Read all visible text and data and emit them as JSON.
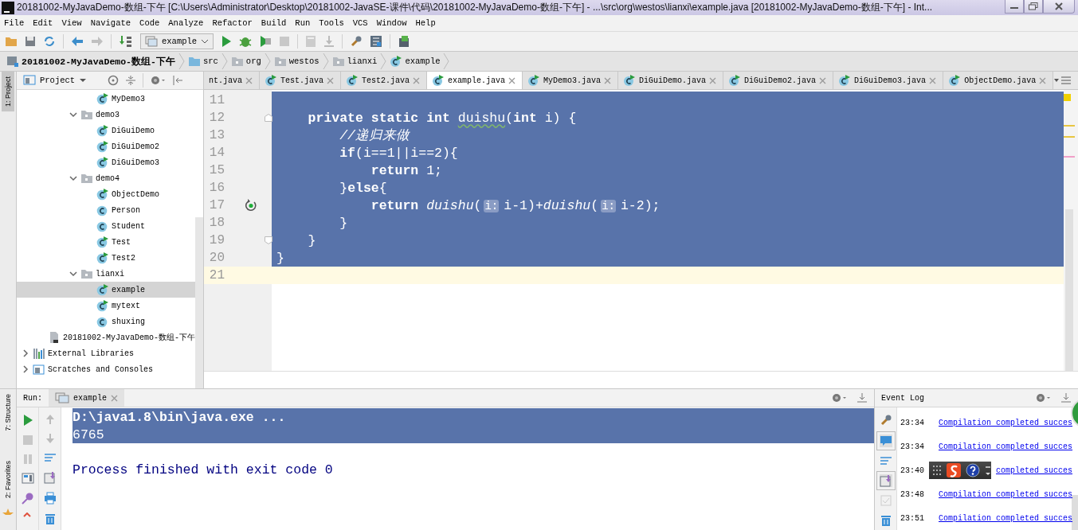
{
  "window": {
    "title": "20181002-MyJavaDemo-数组-下午 [C:\\Users\\Administrator\\Desktop\\20181002-JavaSE-课件\\代码\\20181002-MyJavaDemo-数组-下午] - ...\\src\\org\\westos\\lianxi\\example.java [20181002-MyJavaDemo-数组-下午] - Int..."
  },
  "menu": [
    "File",
    "Edit",
    "View",
    "Navigate",
    "Code",
    "Analyze",
    "Refactor",
    "Build",
    "Run",
    "Tools",
    "VCS",
    "Window",
    "Help"
  ],
  "toolbar": {
    "run_config": "example"
  },
  "breadcrumbs": [
    {
      "label": "20181002-MyJavaDemo-数组-下午",
      "kind": "module"
    },
    {
      "label": "src",
      "kind": "source-folder"
    },
    {
      "label": "org",
      "kind": "package"
    },
    {
      "label": "westos",
      "kind": "package"
    },
    {
      "label": "lianxi",
      "kind": "package"
    },
    {
      "label": "example",
      "kind": "class"
    }
  ],
  "left_strip": {
    "top": [
      {
        "label": "1: Project",
        "selected": true
      }
    ],
    "bottom": [
      {
        "label": "7: Structure",
        "selected": false
      },
      {
        "label": "2: Favorites",
        "selected": false
      }
    ]
  },
  "project": {
    "title": "Project",
    "tree": [
      {
        "children": [
          {
            "children": [
              {
                "children": [
                  {
                    "children": [
                      {
                        "label": "MyDemo3",
                        "kind": "class-main",
                        "selected": false
                      }
                    ]
                  },
                  {
                    "label": "demo3",
                    "kind": "package",
                    "expanded": true,
                    "selected": false,
                    "children": [
                      {
                        "label": "DiGuiDemo",
                        "kind": "class-main",
                        "selected": false
                      },
                      {
                        "label": "DiGuiDemo2",
                        "kind": "class-main",
                        "selected": false
                      },
                      {
                        "label": "DiGuiDemo3",
                        "kind": "class-main",
                        "selected": false
                      }
                    ]
                  },
                  {
                    "label": "demo4",
                    "kind": "package",
                    "expanded": true,
                    "selected": false,
                    "children": [
                      {
                        "label": "ObjectDemo",
                        "kind": "class-main",
                        "selected": false
                      },
                      {
                        "label": "Person",
                        "kind": "class",
                        "selected": false
                      },
                      {
                        "label": "Student",
                        "kind": "class",
                        "selected": false
                      },
                      {
                        "label": "Test",
                        "kind": "class-main",
                        "selected": false
                      },
                      {
                        "label": "Test2",
                        "kind": "class-main",
                        "selected": false
                      }
                    ]
                  },
                  {
                    "label": "lianxi",
                    "kind": "package",
                    "expanded": true,
                    "selected": false,
                    "children": [
                      {
                        "label": "example",
                        "kind": "class-main",
                        "selected": true
                      },
                      {
                        "label": "mytext",
                        "kind": "class-main",
                        "selected": false
                      },
                      {
                        "label": "shuxing",
                        "kind": "class",
                        "selected": false
                      }
                    ]
                  }
                ]
              }
            ]
          },
          {
            "label": "20181002-MyJavaDemo-数组-下午",
            "kind": "module-file",
            "selected": false
          }
        ]
      },
      {
        "label": "External Libraries",
        "kind": "libraries",
        "expanded": false,
        "selected": false
      },
      {
        "label": "Scratches and Consoles",
        "kind": "scratches",
        "expanded": false,
        "selected": false
      }
    ]
  },
  "tabs": [
    {
      "label": "nt.java",
      "kind": "cut",
      "selected": false
    },
    {
      "label": "Test.java",
      "kind": "class",
      "selected": false
    },
    {
      "label": "Test2.java",
      "kind": "class",
      "selected": false
    },
    {
      "label": "example.java",
      "kind": "class",
      "selected": true
    },
    {
      "label": "MyDemo3.java",
      "kind": "class",
      "selected": false
    },
    {
      "label": "DiGuiDemo.java",
      "kind": "class",
      "selected": false
    },
    {
      "label": "DiGuiDemo2.java",
      "kind": "class",
      "selected": false
    },
    {
      "label": "DiGuiDemo3.java",
      "kind": "class",
      "selected": false
    },
    {
      "label": "ObjectDemo.java",
      "kind": "class",
      "selected": false
    }
  ],
  "editor": {
    "lines": [
      {
        "number": "11",
        "kind": "plain",
        "selected": true,
        "current": false
      },
      {
        "number": "12",
        "kind": "fold-start",
        "selected": true,
        "current": false,
        "segments": [
          {
            "t": "    private static int ",
            "kind": "kw"
          },
          {
            "t": "duishu",
            "kind": "decl"
          },
          {
            "t": "(",
            "kind": "plain"
          },
          {
            "t": "int",
            "kind": "kw"
          },
          {
            "t": " i) {",
            "kind": "plain"
          }
        ]
      },
      {
        "number": "13",
        "kind": "plain",
        "selected": true,
        "current": false,
        "segments": [
          {
            "t": "        //递归来做",
            "kind": "comment"
          }
        ]
      },
      {
        "number": "14",
        "kind": "plain",
        "selected": true,
        "current": false,
        "segments": [
          {
            "t": "        if",
            "kind": "kw"
          },
          {
            "t": "(i==1||i==2){",
            "kind": "plain"
          }
        ]
      },
      {
        "number": "15",
        "kind": "plain",
        "selected": true,
        "current": false,
        "segments": [
          {
            "t": "            return",
            "kind": "kw"
          },
          {
            "t": " 1;",
            "kind": "plain"
          }
        ]
      },
      {
        "number": "16",
        "kind": "plain",
        "selected": true,
        "current": false,
        "segments": [
          {
            "t": "        }",
            "kind": "plain"
          },
          {
            "t": "else",
            "kind": "kw"
          },
          {
            "t": "{",
            "kind": "plain"
          }
        ]
      },
      {
        "number": "17",
        "kind": "recursion",
        "selected": true,
        "current": false,
        "segments": [
          {
            "t": "            return ",
            "kind": "kw"
          },
          {
            "t": "duishu",
            "kind": "call"
          },
          {
            "t": "(",
            "kind": "plain"
          },
          {
            "t": "i:",
            "kind": "hint"
          },
          {
            "t": "i-1)+",
            "kind": "plain"
          },
          {
            "t": "duishu",
            "kind": "call"
          },
          {
            "t": "(",
            "kind": "plain"
          },
          {
            "t": "i:",
            "kind": "hint"
          },
          {
            "t": "i-2);",
            "kind": "plain"
          }
        ]
      },
      {
        "number": "18",
        "kind": "plain",
        "selected": true,
        "current": false,
        "segments": [
          {
            "t": "        }",
            "kind": "plain"
          }
        ]
      },
      {
        "number": "19",
        "kind": "fold-end",
        "selected": true,
        "current": false,
        "segments": [
          {
            "t": "    }",
            "kind": "plain"
          }
        ]
      },
      {
        "number": "20",
        "kind": "plain",
        "selected": true,
        "current": false,
        "segments": [
          {
            "t": "}",
            "kind": "plain"
          }
        ]
      },
      {
        "number": "21",
        "kind": "plain",
        "selected": false,
        "current": true
      }
    ]
  },
  "run": {
    "title": "Run:",
    "tab": "example",
    "console": [
      {
        "text": "D:\\java1.8\\bin\\java.exe ...",
        "kind": "command",
        "selected": true
      },
      {
        "text": "6765",
        "kind": "output",
        "selected": true
      },
      {
        "text": "Process finished with exit code 0",
        "kind": "exit",
        "selected": false
      }
    ]
  },
  "event_log": {
    "title": "Event Log",
    "entries": [
      {
        "time": "23:34",
        "message": "Compilation completed succes",
        "kind": "full"
      },
      {
        "time": "23:34",
        "message": "Compilation completed succes",
        "kind": "full"
      },
      {
        "time": "23:40",
        "message": "completed succes",
        "kind": "covered"
      },
      {
        "time": "23:48",
        "message": "Compilation completed succes",
        "kind": "full"
      },
      {
        "time": "23:51",
        "message": "Compilation completed succes",
        "kind": "full"
      }
    ]
  }
}
